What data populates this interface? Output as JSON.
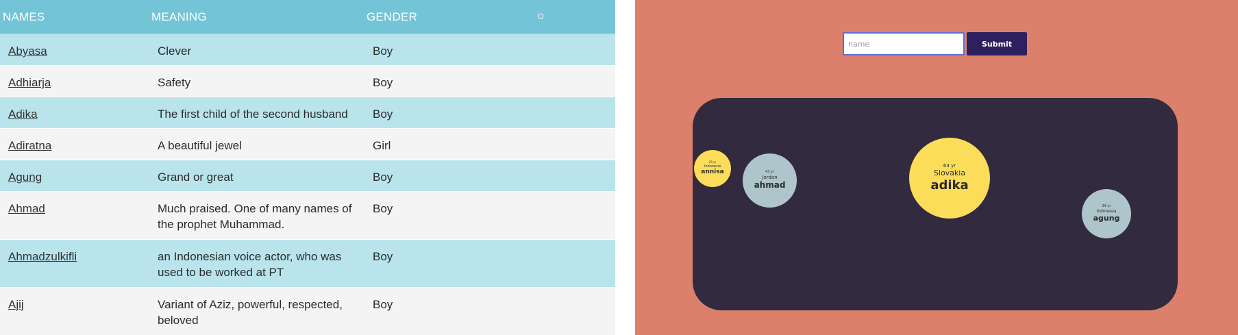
{
  "table": {
    "headers": {
      "names": "NAMES",
      "meaning": "MEANING",
      "gender": "GENDER"
    },
    "toggle_icon": "square-toggle-icon",
    "rows": [
      {
        "name": "Abyasa",
        "meaning": "Clever",
        "gender": "Boy"
      },
      {
        "name": "Adhiarja",
        "meaning": "Safety",
        "gender": "Boy"
      },
      {
        "name": "Adika",
        "meaning": "The first child of the second husband",
        "gender": "Boy"
      },
      {
        "name": "Adiratna",
        "meaning": "A beautiful jewel",
        "gender": "Girl"
      },
      {
        "name": "Agung",
        "meaning": "Grand or great",
        "gender": "Boy"
      },
      {
        "name": "Ahmad",
        "meaning": "Much praised. One of many names of the prophet Muhammad.",
        "gender": "Boy"
      },
      {
        "name": "Ahmadzulkifli",
        "meaning": "an Indonesian voice actor, who was used to be worked at PT",
        "gender": "Boy"
      },
      {
        "name": "Ajij",
        "meaning": "Variant of Aziz, powerful, respected, beloved",
        "gender": "Boy"
      }
    ]
  },
  "form": {
    "input_placeholder": "name",
    "input_value": "",
    "submit_label": "Submit"
  },
  "bubbles": [
    {
      "name": "annisa",
      "country": "Indonesia",
      "age": "29 yr",
      "color": "#fbdd59"
    },
    {
      "name": "ahmad",
      "country": "Jordan",
      "age": "43 yr",
      "color": "#aec5cc"
    },
    {
      "name": "adika",
      "country": "Slovakia",
      "age": "64 yr",
      "color": "#fbdd59"
    },
    {
      "name": "agung",
      "country": "Indonesia",
      "age": "39 yr",
      "color": "#aec5cc"
    }
  ],
  "colors": {
    "table_header": "#74c4d7",
    "row_highlight": "#b9e4ec",
    "row_plain": "#f4f4f4",
    "right_background": "#dc806c",
    "stage_background": "#322a3e",
    "button_background": "#2e1f5e"
  }
}
